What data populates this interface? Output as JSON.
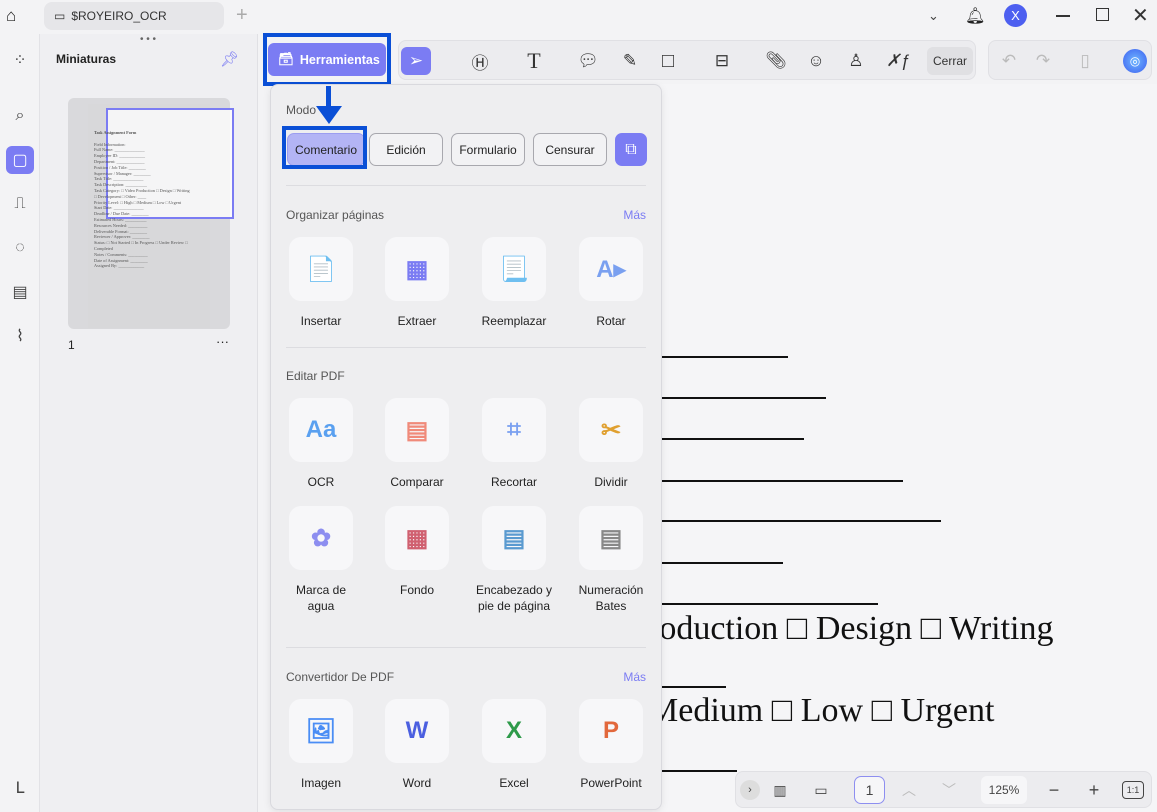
{
  "tab": {
    "title": "$ROYEIRO_OCR"
  },
  "avatar": "X",
  "thumbnails": {
    "title": "Miniaturas",
    "page_number": "1",
    "page_lines": [
      "Task Assignment Form",
      "",
      "Field Information:",
      "Full Name: ______________",
      "Employee ID: ____________",
      "Department: _____________",
      "Position / Job Title: ________",
      "Supervisor / Manager: ________",
      "Task Title: ______________",
      "Task Description: __________",
      "Task Category: □ Video Production □ Design □ Writing",
      "□ Development □ Other: ____",
      "Priority Level: □ High □ Medium □ Low □ Urgent",
      "Start Date: ______________",
      "Deadline / Due Date: ________",
      "Estimated Hours: __________",
      "Resources Needed: _________",
      "Deliverable Format: ________",
      "Reviewer / Approver: ________",
      "Status: □ Not Started □ In Progress □ Under Review □",
      "Completed",
      "Notes / Comments: _________",
      "Date of Assignment: ________",
      "Assigned By: ____________"
    ]
  },
  "toolbar": {
    "tools_label": "Herramientas",
    "close_label": "Cerrar"
  },
  "panel": {
    "mode_label": "Modo",
    "modes": [
      "Comentario",
      "Edición",
      "Formulario",
      "Censurar"
    ],
    "organize": {
      "title": "Organizar páginas",
      "more": "Más",
      "items": [
        "Insertar",
        "Extraer",
        "Reemplazar",
        "Rotar"
      ]
    },
    "edit": {
      "title": "Editar PDF",
      "items": [
        "OCR",
        "Comparar",
        "Recortar",
        "Dividir",
        "Marca de agua",
        "Fondo",
        "Encabezado y pie de página",
        "Numeración Bates"
      ]
    },
    "convert": {
      "title": "Convertidor De PDF",
      "more": "Más",
      "items": [
        "Imagen",
        "Word",
        "Excel",
        "PowerPoint"
      ]
    }
  },
  "document": {
    "line1": "roduction □ Design □ Writing",
    "line2": "Medium □ Low □ Urgent"
  },
  "bottom": {
    "page": "1",
    "zoom": "125%",
    "fit": "1:1"
  },
  "colors": {
    "accent": "#7b7cf3",
    "highlight": "#0a4fd6"
  }
}
